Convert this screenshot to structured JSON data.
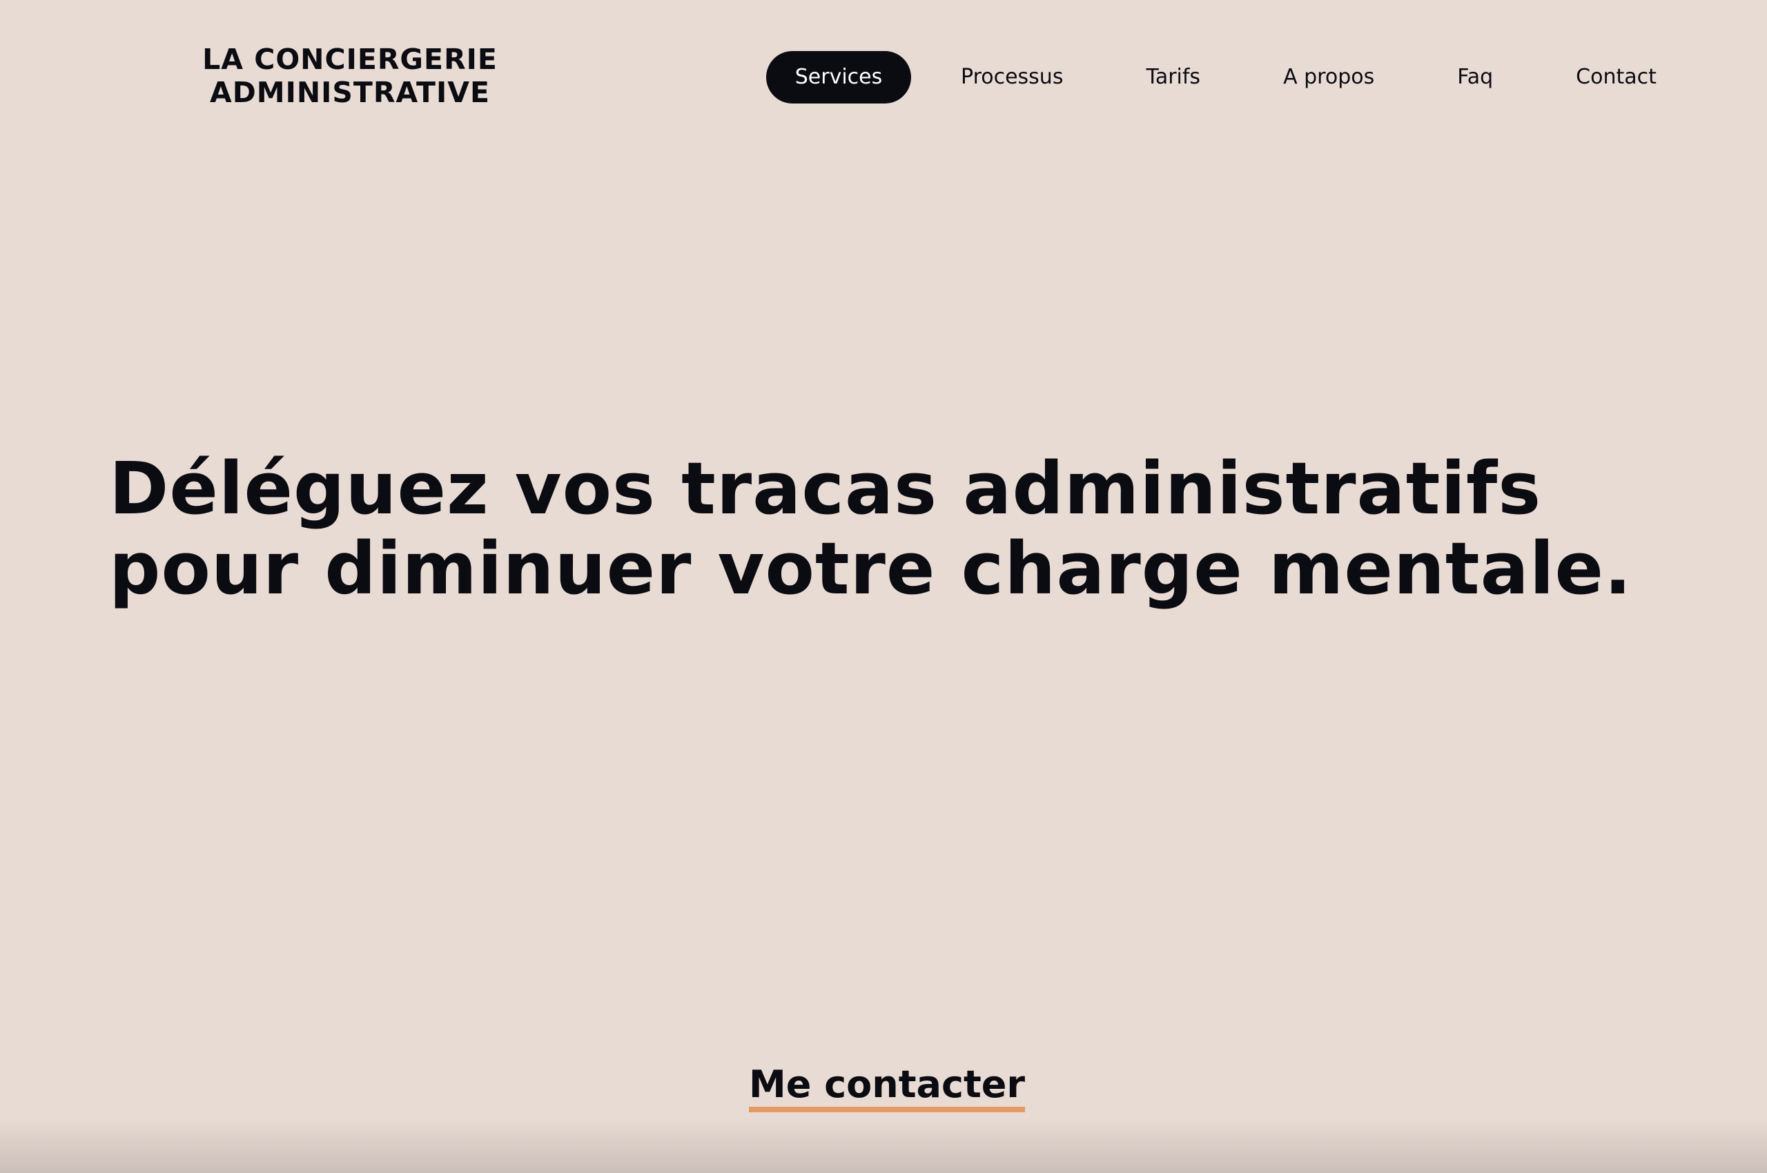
{
  "logo": {
    "line1": "LA CONCIERGERIE",
    "line2": "ADMINISTRATIVE"
  },
  "nav": {
    "items": [
      {
        "label": "Services",
        "active": true
      },
      {
        "label": "Processus",
        "active": false
      },
      {
        "label": "Tarifs",
        "active": false
      },
      {
        "label": "A propos",
        "active": false
      },
      {
        "label": "Faq",
        "active": false
      },
      {
        "label": "Contact",
        "active": false
      }
    ]
  },
  "hero": {
    "line1": "Déléguez vos tracas administratifs",
    "line2": "pour diminuer votre charge mentale."
  },
  "cta": {
    "label": "Me contacter"
  },
  "colors": {
    "background": "#e8dbd4",
    "text": "#0b0b12",
    "accent_underline": "#e39a62",
    "active_pill": "#0b0b12"
  }
}
